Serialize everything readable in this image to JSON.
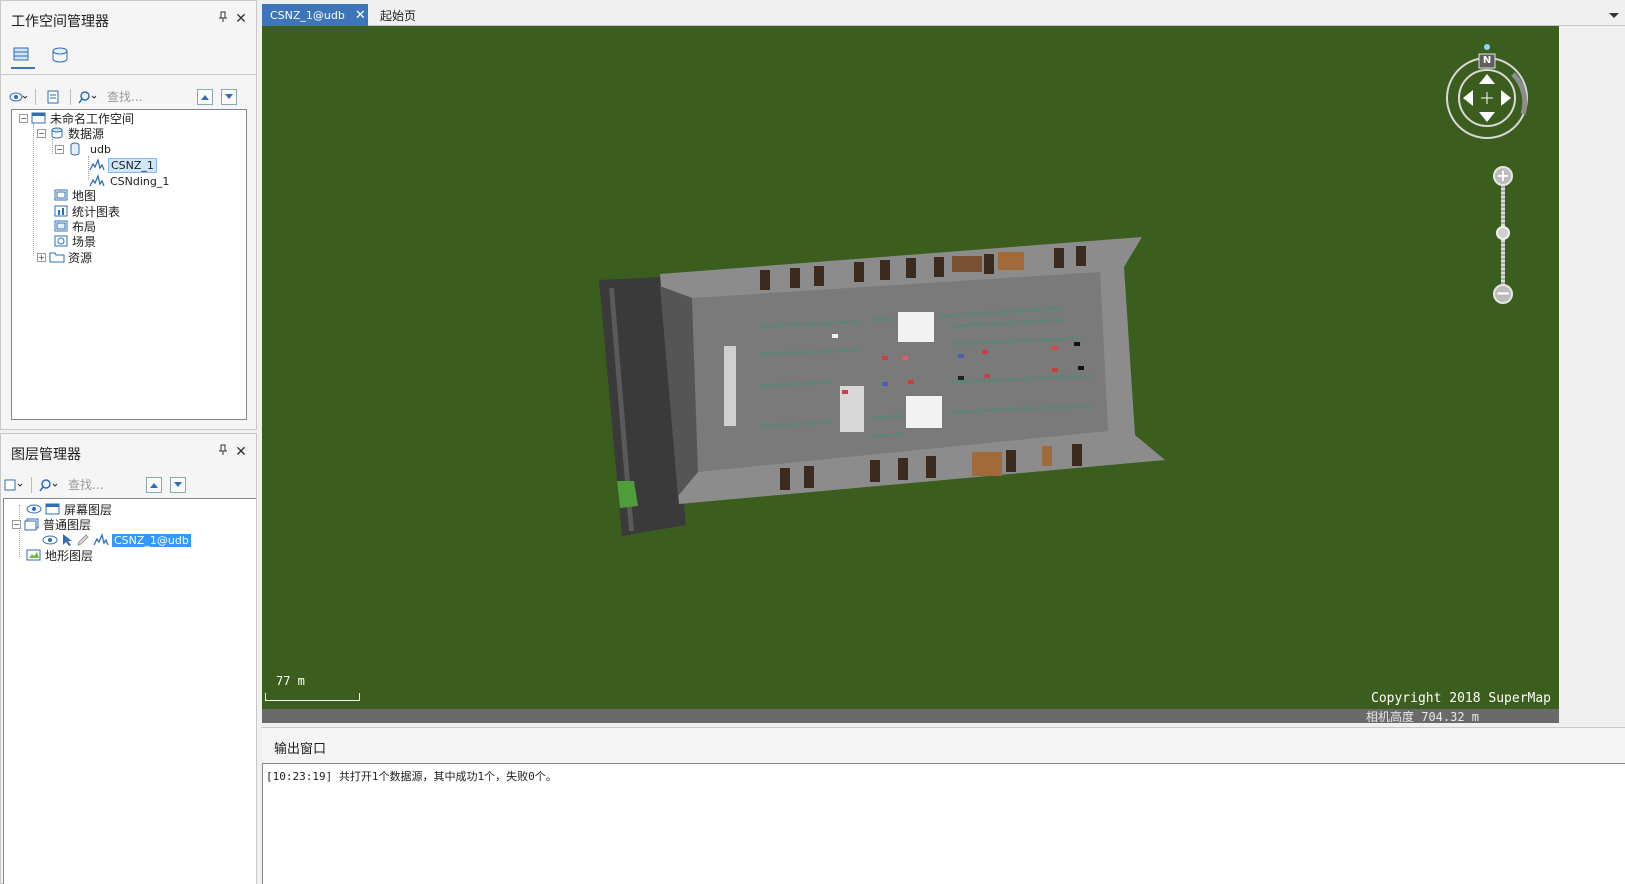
{
  "workspace_panel": {
    "title": "工作空间管理器",
    "search_placeholder": "查找...",
    "tree": {
      "workspace": "未命名工作空间",
      "datasources": "数据源",
      "udb": "udb",
      "dataset_1": "CSNZ_1",
      "dataset_2": "CSNding_1",
      "maps": "地图",
      "charts": "统计图表",
      "layouts": "布局",
      "scenes": "场景",
      "resources": "资源"
    }
  },
  "layer_panel": {
    "title": "图层管理器",
    "search_placeholder": "查找...",
    "tree": {
      "screen_layers": "屏幕图层",
      "normal_layers": "普通图层",
      "layer_1": "CSNZ_1@udb",
      "terrain_layers": "地形图层"
    }
  },
  "doc_tabs": [
    {
      "label": "CSNZ_1@udb",
      "active": true
    },
    {
      "label": "起始页",
      "active": false
    }
  ],
  "scene": {
    "scale_text": "77 m",
    "copyright": "Copyright 2018 SuperMap",
    "camera_height": "相机高度 704.32 m",
    "compass_north": "N",
    "background_color": "#3b5e1e"
  },
  "output": {
    "title": "输出窗口",
    "log": "[10:23:19] 共打开1个数据源，其中成功1个，失败0个。"
  },
  "icons": [
    "pin-icon",
    "close-icon",
    "datasource-tab-icon",
    "scene-tab-icon",
    "search-icon",
    "move-up-icon",
    "move-down-icon",
    "eye-icon",
    "chart-dataset-icon"
  ]
}
